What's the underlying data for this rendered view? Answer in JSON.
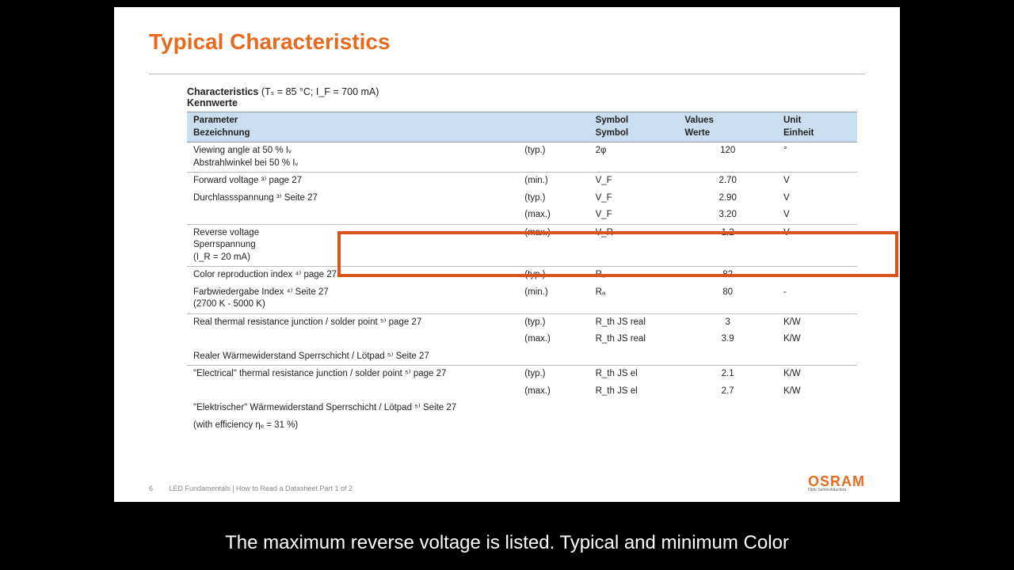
{
  "slide": {
    "title": "Typical Characteristics",
    "char_label": "Characteristics",
    "char_cond": "(Tₛ = 85 °C; I_F = 700 mA)",
    "kennwerte": "Kennwerte",
    "footer_page": "6",
    "footer_text": "LED Fundamentals | How to Read a Datasheet Part 1 of 2",
    "brand": "OSRAM",
    "brand_tag": "Opto Semiconductors"
  },
  "headers": {
    "param_en": "Parameter",
    "param_de": "Bezeichnung",
    "sym_en": "Symbol",
    "sym_de": "Symbol",
    "val_en": "Values",
    "val_de": "Werte",
    "unit_en": "Unit",
    "unit_de": "Einheit"
  },
  "rows": [
    {
      "p": "Viewing angle at 50 % Iᵥ\nAbstrahlwinkel bei 50 % Iᵥ",
      "n": "(typ.)",
      "s": "2φ",
      "v": "120",
      "u": "°"
    },
    {
      "p": "Forward voltage ³⁾ page 27",
      "n": "(min.)",
      "s": "V_F",
      "v": "2.70",
      "u": "V"
    },
    {
      "p": "Durchlassspannung ³⁾ Seite 27",
      "n": "(typ.)",
      "s": "V_F",
      "v": "2.90",
      "u": "V",
      "nb": true
    },
    {
      "p": "",
      "n": "(max.)",
      "s": "V_F",
      "v": "3.20",
      "u": "V",
      "nb": true
    },
    {
      "p": "Reverse voltage\nSperrspannung\n(I_R = 20 mA)",
      "n": "(max.)",
      "s": "V_R",
      "v": "1.2",
      "u": "V",
      "hl": true
    },
    {
      "p": "Color reproduction index ⁴⁾ page 27",
      "n": "(typ.)",
      "s": "Rₐ",
      "v": "82",
      "u": "-"
    },
    {
      "p": "Farbwiedergabe Index ⁴⁾ Seite 27\n(2700 K - 5000 K)",
      "n": "(min.)",
      "s": "Rₐ",
      "v": "80",
      "u": "-",
      "nb": true
    },
    {
      "p": "Real thermal resistance junction / solder point ⁵⁾ page 27",
      "n": "(typ.)",
      "s": "R_th JS real",
      "v": "3",
      "u": "K/W"
    },
    {
      "p": "",
      "n": "(max.)",
      "s": "R_th JS real",
      "v": "3.9",
      "u": "K/W",
      "nb": true
    },
    {
      "p": "Realer Wärmewiderstand Sperrschicht / Lötpad ⁵⁾ Seite 27",
      "n": "",
      "s": "",
      "v": "",
      "u": "",
      "nb": true
    },
    {
      "p": "\"Electrical\" thermal resistance junction / solder point ⁵⁾ page 27",
      "n": "(typ.)",
      "s": "R_th JS el",
      "v": "2.1",
      "u": "K/W"
    },
    {
      "p": "",
      "n": "(max.)",
      "s": "R_th JS el",
      "v": "2.7",
      "u": "K/W",
      "nb": true
    },
    {
      "p": "\"Elektrischer\" Wärmewiderstand Sperrschicht / Lötpad ⁵⁾ Seite 27",
      "n": "",
      "s": "",
      "v": "",
      "u": "",
      "nb": true
    },
    {
      "p": "(with efficiency ηₑ = 31 %)",
      "n": "",
      "s": "",
      "v": "",
      "u": "",
      "nb": true
    }
  ],
  "caption": "The maximum reverse voltage is listed. Typical and minimum Color"
}
